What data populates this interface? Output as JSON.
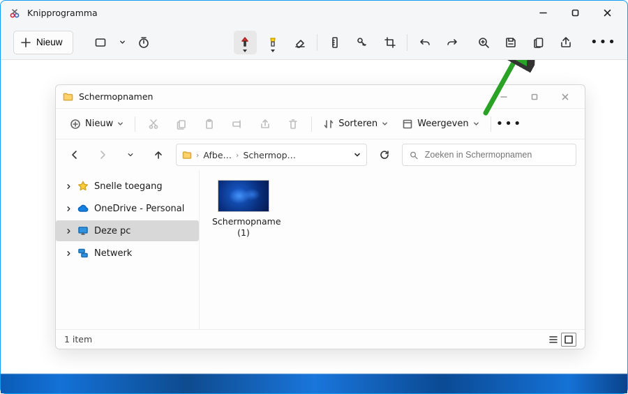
{
  "app": {
    "title": "Knipprogramma",
    "new_label": "Nieuw"
  },
  "explorer": {
    "title": "Schermopnamen",
    "toolbar": {
      "new_label": "Nieuw",
      "sort_label": "Sorteren",
      "view_label": "Weergeven"
    },
    "breadcrumb": {
      "seg1": "Afbe…",
      "seg2": "Schermop…"
    },
    "search_placeholder": "Zoeken in Schermopnamen",
    "sidebar": [
      {
        "label": "Snelle toegang"
      },
      {
        "label": "OneDrive - Personal"
      },
      {
        "label": "Deze pc"
      },
      {
        "label": "Netwerk"
      }
    ],
    "files": [
      {
        "name_line1": "Schermopname",
        "name_line2": "(1)"
      }
    ],
    "status": "1 item"
  }
}
